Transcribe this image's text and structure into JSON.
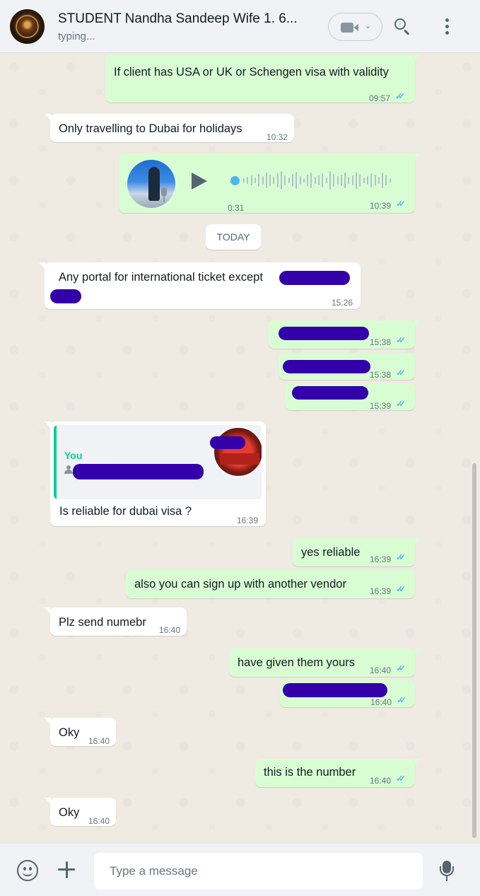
{
  "header": {
    "title": "STUDENT Nandha Sandeep Wife 1. 6...",
    "status": "typing...",
    "icons": [
      "video-call-icon",
      "chevron-down-icon",
      "search-icon",
      "menu-icon"
    ]
  },
  "chat": {
    "date_chip": "TODAY",
    "messages": [
      {
        "dir": "out",
        "text": "If client has USA or UK or Schengen visa with validity",
        "time": "09:57",
        "status": "read"
      },
      {
        "dir": "in",
        "text": "Only travelling to Dubai for holidays",
        "time": "10:32"
      },
      {
        "dir": "out",
        "type": "voice",
        "duration": "0:31",
        "time": "10:39",
        "status": "read"
      },
      {
        "dir": "in",
        "text": "Any portal for international ticket except",
        "time": "15:26",
        "redacted": true
      },
      {
        "dir": "out",
        "text": "",
        "time": "15:38",
        "status": "read",
        "redacted": true
      },
      {
        "dir": "out",
        "text": "",
        "time": "15:38",
        "status": "read",
        "redacted": true
      },
      {
        "dir": "out",
        "text": "",
        "time": "15:39",
        "status": "read",
        "redacted": true
      },
      {
        "dir": "in",
        "type": "reply",
        "quote_author": "You",
        "text": "Is reliable for dubai visa ?",
        "time": "16:39"
      },
      {
        "dir": "out",
        "text": "yes reliable",
        "time": "16:39",
        "status": "read"
      },
      {
        "dir": "out",
        "text": "also you can sign up with another vendor",
        "time": "16:39",
        "status": "read"
      },
      {
        "dir": "in",
        "text": "Plz send numebr",
        "time": "16:40"
      },
      {
        "dir": "out",
        "text": "have given them yours",
        "time": "16:40",
        "status": "read"
      },
      {
        "dir": "out",
        "text": "",
        "time": "16:40",
        "status": "read",
        "redacted": true
      },
      {
        "dir": "in",
        "text": "Oky",
        "time": "16:40"
      },
      {
        "dir": "out",
        "text": "this is the number",
        "time": "16:40",
        "status": "read"
      },
      {
        "dir": "in",
        "text": "Oky",
        "time": "16:40"
      }
    ]
  },
  "composer": {
    "placeholder": "Type a message",
    "icons": [
      "emoji-icon",
      "plus-icon",
      "mic-icon"
    ]
  },
  "colors": {
    "outgoing_bubble": "#d9fdd3",
    "incoming_bubble": "#ffffff",
    "read_tick": "#53bdeb",
    "reply_accent": "#06cf9c",
    "redaction": "#3300aa"
  }
}
